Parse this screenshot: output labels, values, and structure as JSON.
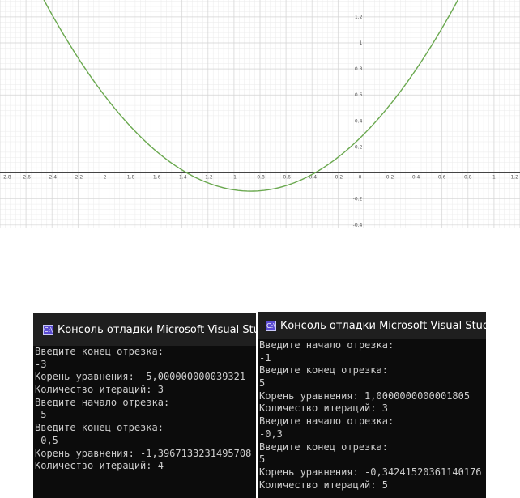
{
  "graph": {
    "x_range": [
      -2.8,
      1.2
    ],
    "y_range": [
      -0.42,
      1.33
    ],
    "x_ticks": [
      "-2.8",
      "-2.6",
      "-2.4",
      "-2.2",
      "-2",
      "-1.8",
      "-1.6",
      "-1.4",
      "-1.2",
      "-1",
      "-0.8",
      "-0.6",
      "-0.4",
      "-0.2",
      "0",
      "0.2",
      "0.4",
      "0.6",
      "0.8",
      "1",
      "1.2"
    ],
    "y_ticks": [
      "1.2",
      "1",
      "0.8",
      "0.6",
      "0.4",
      "0.2",
      "-0.2",
      "-0.4"
    ],
    "curve": {
      "vertex_x": -0.87,
      "vertex_y": -0.14,
      "a": 0.58,
      "color": "#6aa84f"
    },
    "grid_minor_color": "#ebebeb",
    "grid_major_color": "#d4d4d4",
    "axis_color": "#444444"
  },
  "consoles": [
    {
      "title": "Консоль отладки Microsoft Visual Studio",
      "icon_text": "C:\\",
      "lines": [
        "Введите конец отрезка:",
        "-3",
        "Корень уравнения: -5,000000000039321",
        "Количество итераций: 3",
        "Введите начало отрезка:",
        "-5",
        "Введите конец отрезка:",
        "-0,5",
        "Корень уравнения: -1,3967133231495708",
        "Количество итераций: 4"
      ]
    },
    {
      "title": "Консоль отладки Microsoft Visual Studio",
      "icon_text": "C:\\",
      "lines": [
        "Введите начало отрезка:",
        "-1",
        "Введите конец отрезка:",
        "5",
        "Корень уравнения: 1,0000000000001805",
        "Количество итераций: 3",
        "Введите начало отрезка:",
        "-0,3",
        "Введите конец отрезка:",
        "5",
        "Корень уравнения: -0,34241520361140176",
        "Количество итераций: 5"
      ]
    }
  ]
}
